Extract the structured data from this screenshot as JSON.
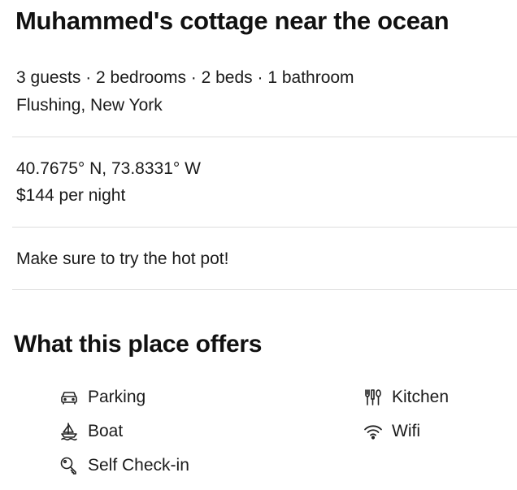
{
  "listing": {
    "title": "Muhammed's cottage near the ocean",
    "summary": "3 guests · 2 bedrooms · 2 beds · 1 bathroom",
    "location": "Flushing, New York",
    "coordinates": "40.7675° N, 73.8331° W",
    "price": "$144 per night",
    "note": "Make sure to try the hot pot!"
  },
  "offers": {
    "title": "What this place offers",
    "items": [
      {
        "label": "Parking",
        "icon": "car-icon"
      },
      {
        "label": "Kitchen",
        "icon": "kitchen-utensils-icon"
      },
      {
        "label": "Boat",
        "icon": "boat-icon"
      },
      {
        "label": "Wifi",
        "icon": "wifi-icon"
      },
      {
        "label": "Self Check-in",
        "icon": "key-icon"
      }
    ]
  }
}
